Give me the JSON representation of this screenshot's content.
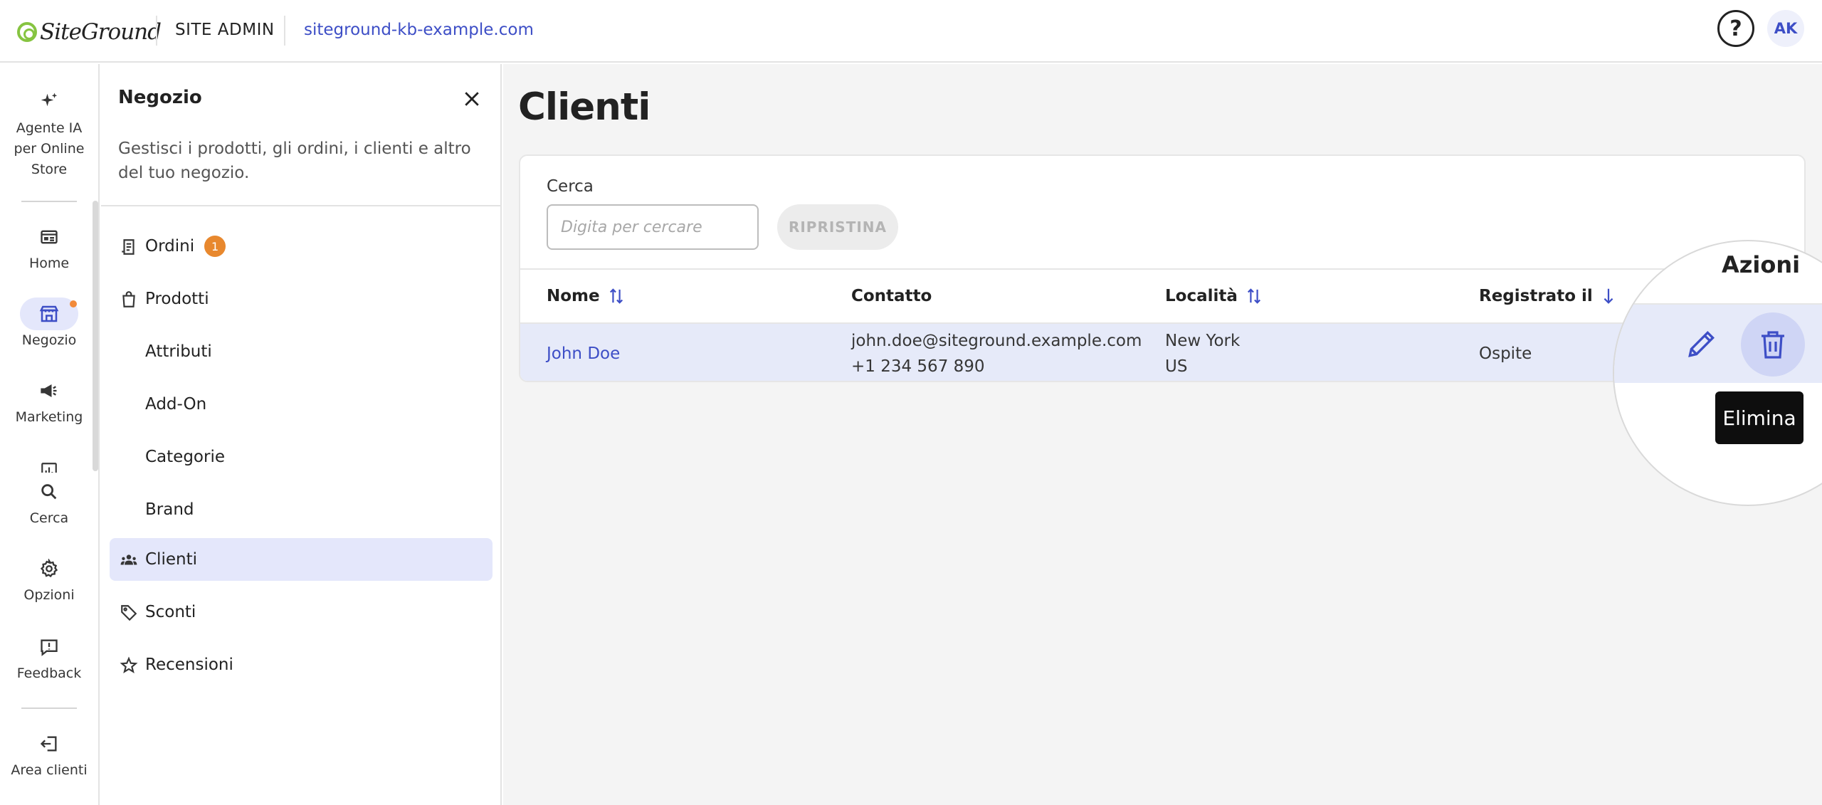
{
  "header": {
    "logo_text": "SiteGround",
    "section": "SITE ADMIN",
    "domain": "siteground-kb-example.com",
    "help_symbol": "?",
    "avatar_initials": "AK"
  },
  "rail": {
    "items": [
      {
        "label_lines": [
          "Agente IA",
          "per Online",
          "Store"
        ],
        "icon": "sparkle-icon"
      },
      {
        "label": "Home",
        "icon": "home-icon"
      },
      {
        "label": "Negozio",
        "icon": "store-icon",
        "active": true,
        "notification": true
      },
      {
        "label": "Marketing",
        "icon": "megaphone-icon"
      },
      {
        "label": "Cerca",
        "icon": "search-icon"
      },
      {
        "label": "Opzioni",
        "icon": "gear-icon"
      },
      {
        "label": "Feedback",
        "icon": "feedback-icon"
      },
      {
        "label": "Area clienti",
        "icon": "exit-icon"
      }
    ]
  },
  "panel": {
    "title": "Negozio",
    "description": "Gestisci i prodotti, gli ordini, i clienti e altro del tuo negozio.",
    "nav": [
      {
        "label": "Ordini",
        "icon": "orders-icon",
        "badge": "1"
      },
      {
        "label": "Prodotti",
        "icon": "bag-icon"
      },
      {
        "label": "Attributi"
      },
      {
        "label": "Add-On"
      },
      {
        "label": "Categorie"
      },
      {
        "label": "Brand"
      },
      {
        "label": "Clienti",
        "icon": "users-icon",
        "active": true
      },
      {
        "label": "Sconti",
        "icon": "tag-icon"
      },
      {
        "label": "Recensioni",
        "icon": "star-icon"
      }
    ]
  },
  "main": {
    "title": "Clienti",
    "search": {
      "label": "Cerca",
      "placeholder": "Digita per cercare",
      "value": "",
      "reset_label": "RIPRISTINA"
    },
    "table": {
      "columns": [
        "Nome",
        "Contatto",
        "Località",
        "Registrato il",
        "Azioni"
      ],
      "rows": [
        {
          "name": "John Doe",
          "email": "john.doe@siteground.example.com",
          "phone": "+1 234 567 890",
          "city": "New York",
          "country": "US",
          "registered": "Ospite"
        }
      ]
    },
    "tooltip": "Elimina"
  },
  "colors": {
    "accent": "#3d4ec6",
    "accent_light": "#e4e7fb",
    "badge": "#e8882e",
    "brand_green": "#86c441"
  }
}
